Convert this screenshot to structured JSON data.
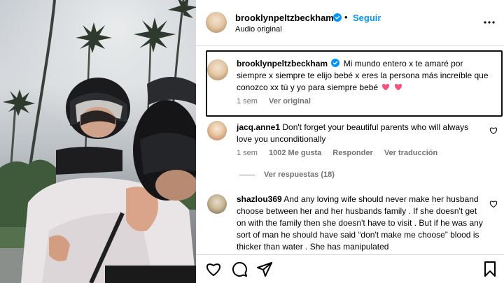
{
  "post": {
    "username": "brooklynpeltzbeckham",
    "separator": "•",
    "follow_label": "Seguir",
    "audio_label": "Audio original"
  },
  "caption": {
    "username": "brooklynpeltzbeckham",
    "text": "Mi mundo entero x te amaré por siempre x siempre te elijo bebé x eres la persona más increíble que conozco xx tú y yo para siempre bebé",
    "time": "1 sem",
    "see_translation": "Ver original"
  },
  "comments": [
    {
      "username": "jacq.anne1",
      "text": "Don't forget your beautiful parents who will always love you unconditionally",
      "time": "1 sem",
      "likes": "1002 Me gusta",
      "reply": "Responder",
      "translation": "Ver traducción",
      "view_replies": "Ver respuestas (18)"
    },
    {
      "username": "shazlou369",
      "text": "And any loving wife should never make her husband choose between her and her husbands family . If she doesn't get on with the family then she doesn't have to visit . But if he was any sort of man he should have said “don't make me choose” blood is thicker than water . She has manipulated"
    }
  ],
  "icons": {
    "header_more": "more-options-icon",
    "verified": "verified-badge-icon",
    "comment_like": "heart-icon",
    "footer": [
      "heart-icon",
      "comment-icon",
      "share-icon",
      "bookmark-icon"
    ],
    "heart_emoji": "pink-heart-emoji"
  },
  "colors": {
    "link_blue": "#0095f6",
    "verified_blue": "#0095f6",
    "secondary_text": "#737373",
    "heart_pink": "#f2567f"
  }
}
